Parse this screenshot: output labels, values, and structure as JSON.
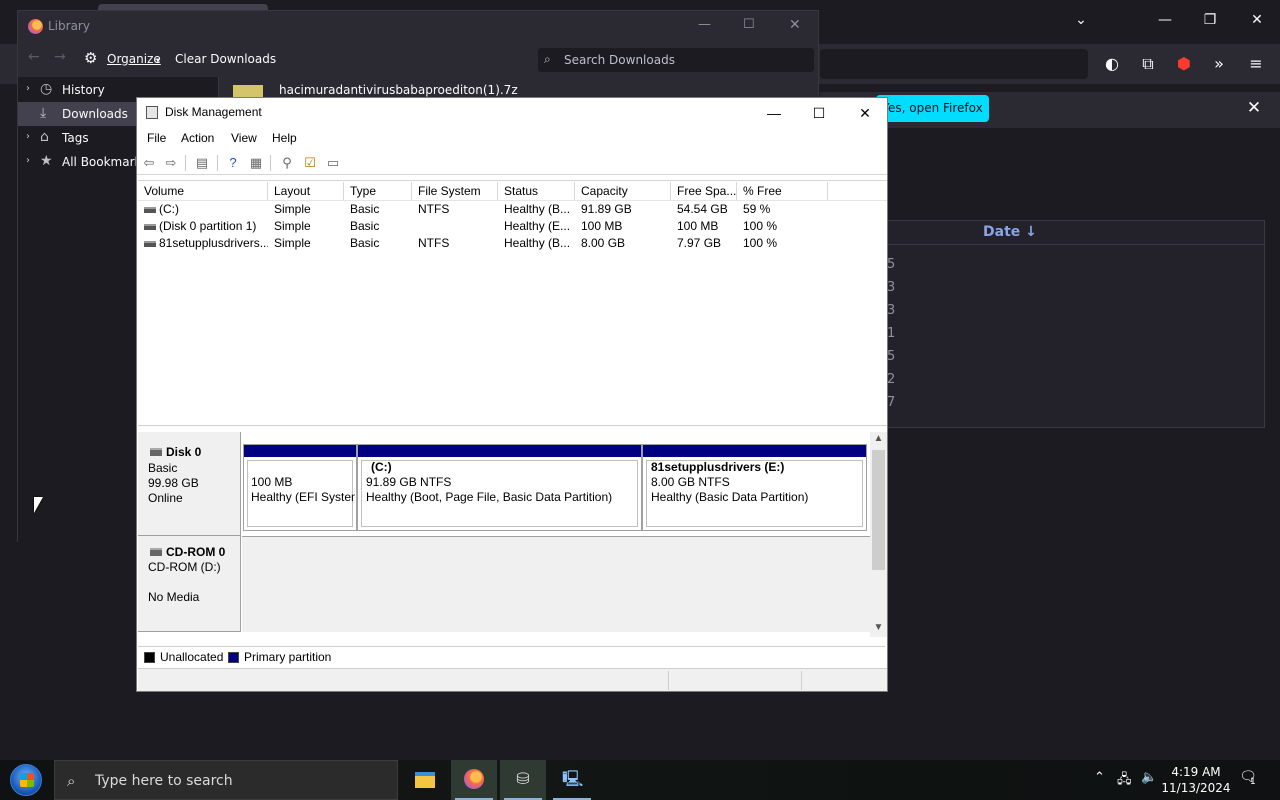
{
  "firefox": {
    "notification_button": "Yes, open Firefox",
    "downloads_date_header": "Date ↓",
    "downloads_fragments": [
      "5",
      "3",
      "3",
      "1",
      "5",
      "2",
      "7"
    ]
  },
  "library": {
    "title": "Library",
    "toolbar": {
      "organize": "Organize",
      "clear_downloads": "Clear Downloads",
      "search_placeholder": "Search Downloads"
    },
    "sidebar": [
      {
        "label": "History",
        "icon": "clock-icon"
      },
      {
        "label": "Downloads",
        "icon": "download-icon"
      },
      {
        "label": "Tags",
        "icon": "tag-icon"
      },
      {
        "label": "All Bookmarks",
        "icon": "star-icon"
      }
    ],
    "file_name": "hacimuradantivirusbabaproediton(1).7z"
  },
  "disk_management": {
    "title": "Disk Management",
    "menu": [
      "File",
      "Action",
      "View",
      "Help"
    ],
    "columns": [
      "Volume",
      "Layout",
      "Type",
      "File System",
      "Status",
      "Capacity",
      "Free Spa...",
      "% Free"
    ],
    "rows": [
      [
        "(C:)",
        "Simple",
        "Basic",
        "NTFS",
        "Healthy (B...",
        "91.89 GB",
        "54.54 GB",
        "59 %"
      ],
      [
        "(Disk 0 partition 1)",
        "Simple",
        "Basic",
        "",
        "Healthy (E...",
        "100 MB",
        "100 MB",
        "100 %"
      ],
      [
        "81setupplusdrivers...",
        "Simple",
        "Basic",
        "NTFS",
        "Healthy (B...",
        "8.00 GB",
        "7.97 GB",
        "100 %"
      ]
    ],
    "disk0": {
      "name": "Disk 0",
      "type": "Basic",
      "size": "99.98 GB",
      "status": "Online",
      "partitions": [
        {
          "name": "",
          "size": "100 MB",
          "status": "Healthy (EFI System"
        },
        {
          "name": "(C:)",
          "size": "91.89 GB NTFS",
          "status": "Healthy (Boot, Page File, Basic Data Partition)"
        },
        {
          "name": "81setupplusdrivers  (E:)",
          "size": "8.00 GB NTFS",
          "status": "Healthy (Basic Data Partition)"
        }
      ]
    },
    "cdrom": {
      "name": "CD-ROM 0",
      "drive": "CD-ROM (D:)",
      "status": "No Media"
    },
    "legend": [
      {
        "label": "Unallocated",
        "color": "#000000"
      },
      {
        "label": "Primary partition",
        "color": "#000080"
      }
    ]
  },
  "taskbar": {
    "search_placeholder": "Type here to search",
    "time": "4:19 AM",
    "date": "11/13/2024",
    "notification_count": "1"
  }
}
